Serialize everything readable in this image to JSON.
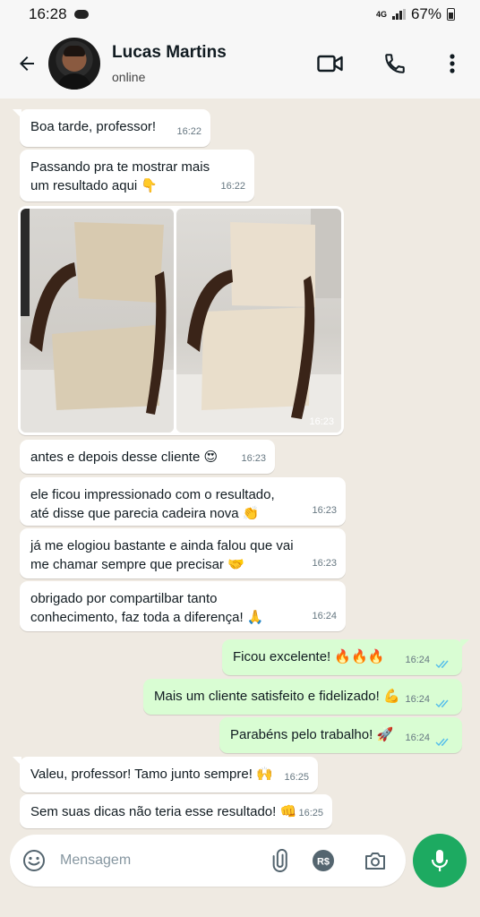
{
  "status_bar": {
    "time": "16:28",
    "network": "4G",
    "battery": "67%"
  },
  "header": {
    "name": "Lucas Martins",
    "status": "online"
  },
  "messages": [
    {
      "text": "Boa tarde, professor!",
      "time": "16:22"
    },
    {
      "line1": "Passando pra te mostrar mais",
      "line2": "um resultado aqui 👇",
      "time": "16:22"
    },
    {
      "photo_time": "16:23"
    },
    {
      "text": "antes e depois desse cliente 😍",
      "time": "16:23"
    },
    {
      "line1": "ele ficou impressionado com o resultado,",
      "line2": "até disse que parecia cadeira nova 👏",
      "time": "16:23"
    },
    {
      "line1": "já me elogiou bastante e ainda falou que vai",
      "line2": "me chamar sempre que precisar 🤝",
      "time": "16:23"
    },
    {
      "line1": "obrigado por compartilbar tanto",
      "line2": "conhecimento, faz toda a diferença! 🙏",
      "time": "16:24"
    },
    {
      "text": "Ficou excelente! 🔥🔥🔥",
      "time": "16:24"
    },
    {
      "text": "Mais um cliente satisfeito e fidelizado! 💪",
      "time": "16:24"
    },
    {
      "text": "Parabéns pelo trabalho! 🚀",
      "time": "16:24"
    },
    {
      "text": "Valeu, professor! Tamo junto sempre! 🙌",
      "time": "16:25"
    },
    {
      "text": "Sem suas dicas não teria esse resultado! 👊",
      "time": "16:25"
    }
  ],
  "composer": {
    "placeholder": "Mensagem"
  },
  "colors": {
    "outgoing": "#d9fdd3",
    "incoming": "#ffffff",
    "background": "#efeae2",
    "accent": "#1daa61",
    "read_ticks": "#53bdeb"
  },
  "icons": [
    "back-arrow-icon",
    "video-call-icon",
    "phone-icon",
    "more-options-icon",
    "emoji-icon",
    "attach-icon",
    "payment-icon",
    "camera-icon",
    "mic-icon"
  ]
}
